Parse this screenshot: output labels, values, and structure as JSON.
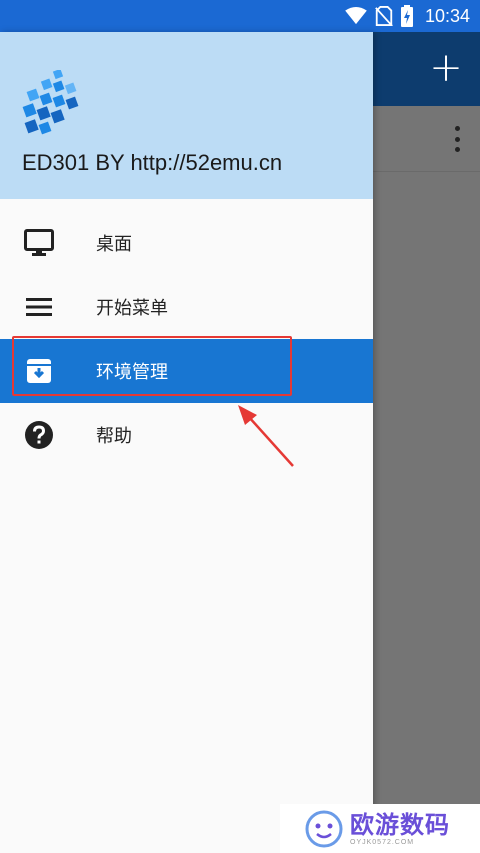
{
  "status_bar": {
    "time": "10:34",
    "icons": [
      "wifi-icon",
      "no-sim-icon",
      "battery-charging-icon"
    ]
  },
  "toolbar": {
    "add_icon": "plus-icon",
    "overflow_icon": "more-vert-icon"
  },
  "drawer": {
    "title": "ED301 BY http://52emu.cn",
    "items": [
      {
        "label": "桌面",
        "icon": "monitor-icon",
        "active": false
      },
      {
        "label": "开始菜单",
        "icon": "menu-lines-icon",
        "active": false
      },
      {
        "label": "环境管理",
        "icon": "archive-download-icon",
        "active": true
      },
      {
        "label": "帮助",
        "icon": "help-circle-icon",
        "active": false
      }
    ]
  },
  "colors": {
    "status_bar": "#1b69d3",
    "header_bg": "#bcdcf5",
    "active_item": "#1876d2",
    "highlight_border": "#e53935",
    "scrim": "#757575"
  },
  "watermark": {
    "main": "欧游数码",
    "sub": "OYJK0572.COM"
  }
}
